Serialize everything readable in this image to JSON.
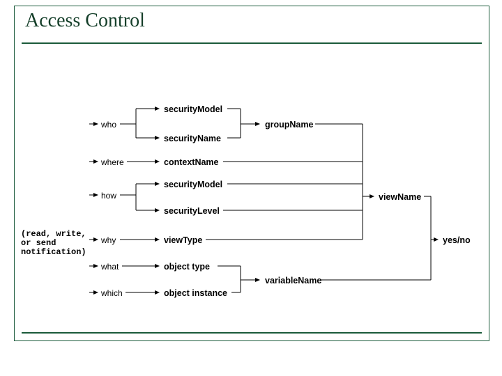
{
  "title": "Access Control",
  "annotation": "(read, write,\nor send\nnotification)",
  "inputs": {
    "who": "who",
    "where": "where",
    "how": "how",
    "why": "why",
    "what": "what",
    "which": "which"
  },
  "props": {
    "securityModel1": "securityModel",
    "securityName": "securityName",
    "contextName": "contextName",
    "securityModel2": "securityModel",
    "securityLevel": "securityLevel",
    "viewType": "viewType",
    "objectType": "object type",
    "objectInstance": "object instance"
  },
  "outputs": {
    "groupName": "groupName",
    "viewName": "viewName",
    "variableName": "variableName",
    "yesNo": "yes/no"
  }
}
